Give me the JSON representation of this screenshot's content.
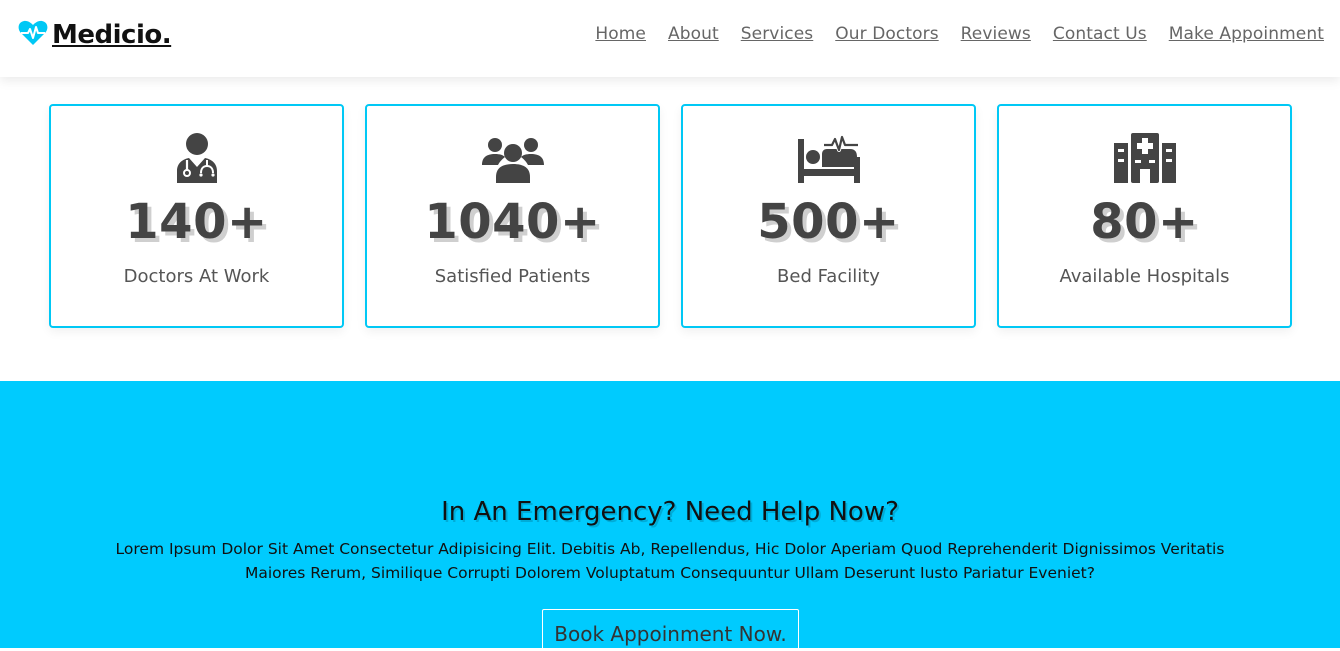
{
  "brand": {
    "name": "Medicio.",
    "icon": "heartbeat-icon",
    "accent_color": "#00c8f5"
  },
  "nav": [
    {
      "label": "Home"
    },
    {
      "label": "About"
    },
    {
      "label": "Services"
    },
    {
      "label": "Our Doctors"
    },
    {
      "label": "Reviews"
    },
    {
      "label": "Contact Us"
    },
    {
      "label": "Make Appoinment"
    }
  ],
  "stats": [
    {
      "icon": "doctor-icon",
      "value": "140+",
      "label": "Doctors At Work"
    },
    {
      "icon": "patients-group-icon",
      "value": "1040+",
      "label": "Satisfied Patients"
    },
    {
      "icon": "hospital-bed-icon",
      "value": "500+",
      "label": "Bed Facility"
    },
    {
      "icon": "hospital-building-icon",
      "value": "80+",
      "label": "Available Hospitals"
    }
  ],
  "emergency": {
    "title": "In An Emergency? Need Help Now?",
    "text": "Lorem Ipsum Dolor Sit Amet Consectetur Adipisicing Elit. Debitis Ab, Repellendus, Hic Dolor Aperiam Quod Reprehenderit Dignissimos Veritatis Maiores Rerum, Similique Corrupti Dolorem Voluptatum Consequuntur Ullam Deserunt Iusto Pariatur Eveniet?",
    "button_label": "Book Appoinment Now.",
    "background_color": "#00cbfe"
  }
}
